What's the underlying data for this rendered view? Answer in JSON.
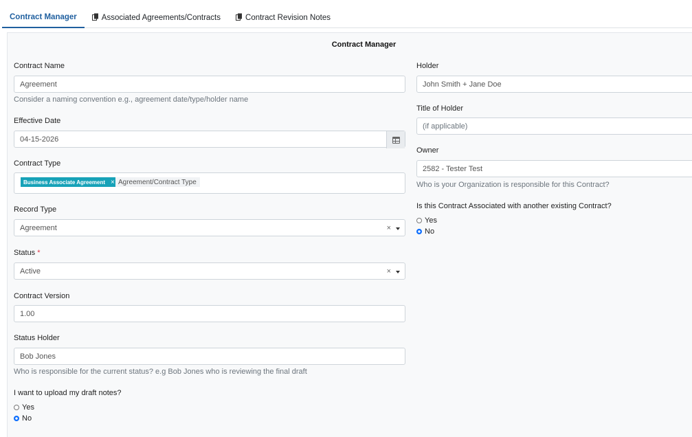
{
  "tabs": [
    {
      "label": "Contract Manager",
      "active": true
    },
    {
      "label": "Associated Agreements/Contracts",
      "active": false,
      "icon": "documents-icon"
    },
    {
      "label": "Contract Revision Notes",
      "active": false,
      "icon": "documents-icon"
    }
  ],
  "card": {
    "title": "Contract Manager"
  },
  "left": {
    "contract_name": {
      "label": "Contract Name",
      "value": "Agreement",
      "help": "Consider a naming convention e.g., agreement date/type/holder name"
    },
    "effective_date": {
      "label": "Effective Date",
      "value": "04-15-2026",
      "icon": "calendar-icon"
    },
    "contract_type": {
      "label": "Contract Type",
      "tag": "Business Associate Agreement",
      "tag_remove": "×",
      "placeholder": "Agreement/Contract Type"
    },
    "record_type": {
      "label": "Record Type",
      "value": "Agreement",
      "clear": "×"
    },
    "status": {
      "label": "Status",
      "required_mark": "*",
      "value": "Active",
      "clear": "×"
    },
    "contract_version": {
      "label": "Contract Version",
      "value": "1.00"
    },
    "status_holder": {
      "label": "Status Holder",
      "value": "Bob Jones",
      "help": "Who is responsible for the current status? e.g Bob Jones who is reviewing the final draft"
    },
    "upload_notes": {
      "label": "I want to upload my draft notes?",
      "options": [
        "Yes",
        "No"
      ],
      "selected": "No"
    }
  },
  "right": {
    "holder": {
      "label": "Holder",
      "value": "John Smith + Jane Doe"
    },
    "title_of_holder": {
      "label": "Title of Holder",
      "placeholder": "(if applicable)"
    },
    "owner": {
      "label": "Owner",
      "value": "2582 - Tester Test",
      "help": "Who is your Organization is responsible for this Contract?"
    },
    "associated": {
      "label": "Is this Contract Associated with another existing Contract?",
      "options": [
        "Yes",
        "No"
      ],
      "selected": "No"
    }
  },
  "colors": {
    "accent": "#1f5f9f",
    "tag": "#17a2b8",
    "required": "#dc3545"
  }
}
